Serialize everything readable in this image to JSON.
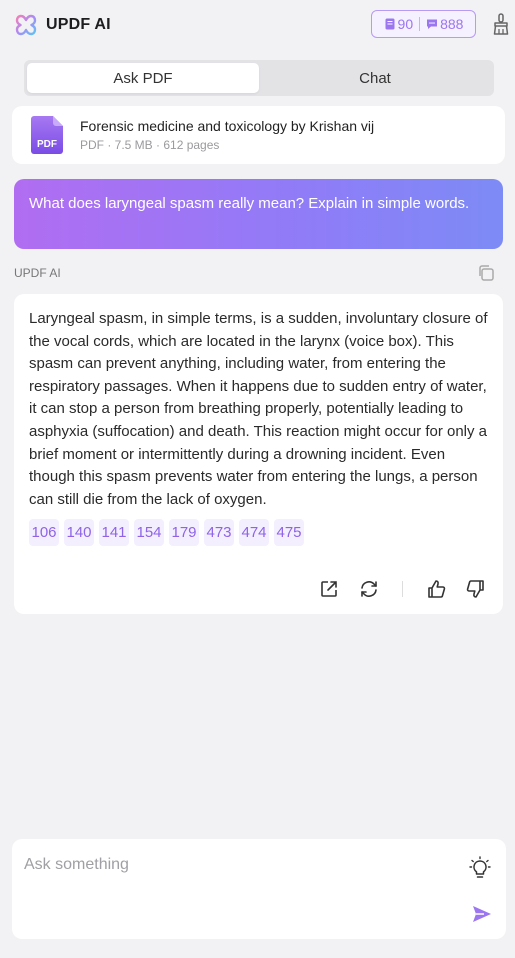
{
  "header": {
    "title": "UPDF AI",
    "quota_docs": "90",
    "quota_msgs": "888",
    "accent": "#9b76f0"
  },
  "tabs": [
    {
      "label": "Ask PDF",
      "active": true
    },
    {
      "label": "Chat",
      "active": false
    }
  ],
  "file": {
    "icon_label": "PDF",
    "name": "Forensic medicine and toxicology  by Krishan vij",
    "meta": "PDF · 7.5 MB · 612 pages"
  },
  "user_message": "What does laryngeal spasm really mean? Explain in simple words.",
  "ai": {
    "label": "UPDF AI",
    "answer": "Laryngeal spasm, in simple terms, is a sudden, involuntary closure of the vocal cords, which are located in the larynx (voice box). This spasm can prevent anything, including water, from entering the respiratory passages. When it happens due to sudden entry of water, it can stop a person from breathing properly, potentially leading to asphyxia (suffocation) and death. This reaction might occur for only a brief moment or intermittently during a drowning incident. Even though this spasm prevents water from entering the lungs, a person can still die from the lack of oxygen.",
    "pages": [
      "106",
      "140",
      "141",
      "154",
      "179",
      "473",
      "474",
      "475"
    ]
  },
  "input": {
    "placeholder": "Ask something",
    "value": ""
  },
  "icons": {
    "logo": "updf-logo-icon",
    "clean": "broom-icon",
    "copy": "copy-icon",
    "export": "export-icon",
    "regenerate": "regenerate-icon",
    "like": "thumbs-up-icon",
    "dislike": "thumbs-down-icon",
    "bulb": "lightbulb-icon",
    "send": "send-icon"
  },
  "colors": {
    "bubble_start": "#b16df2",
    "bubble_end": "#7d8bf6",
    "page_chip_text": "#8e63e6",
    "send": "#9b76f0"
  }
}
